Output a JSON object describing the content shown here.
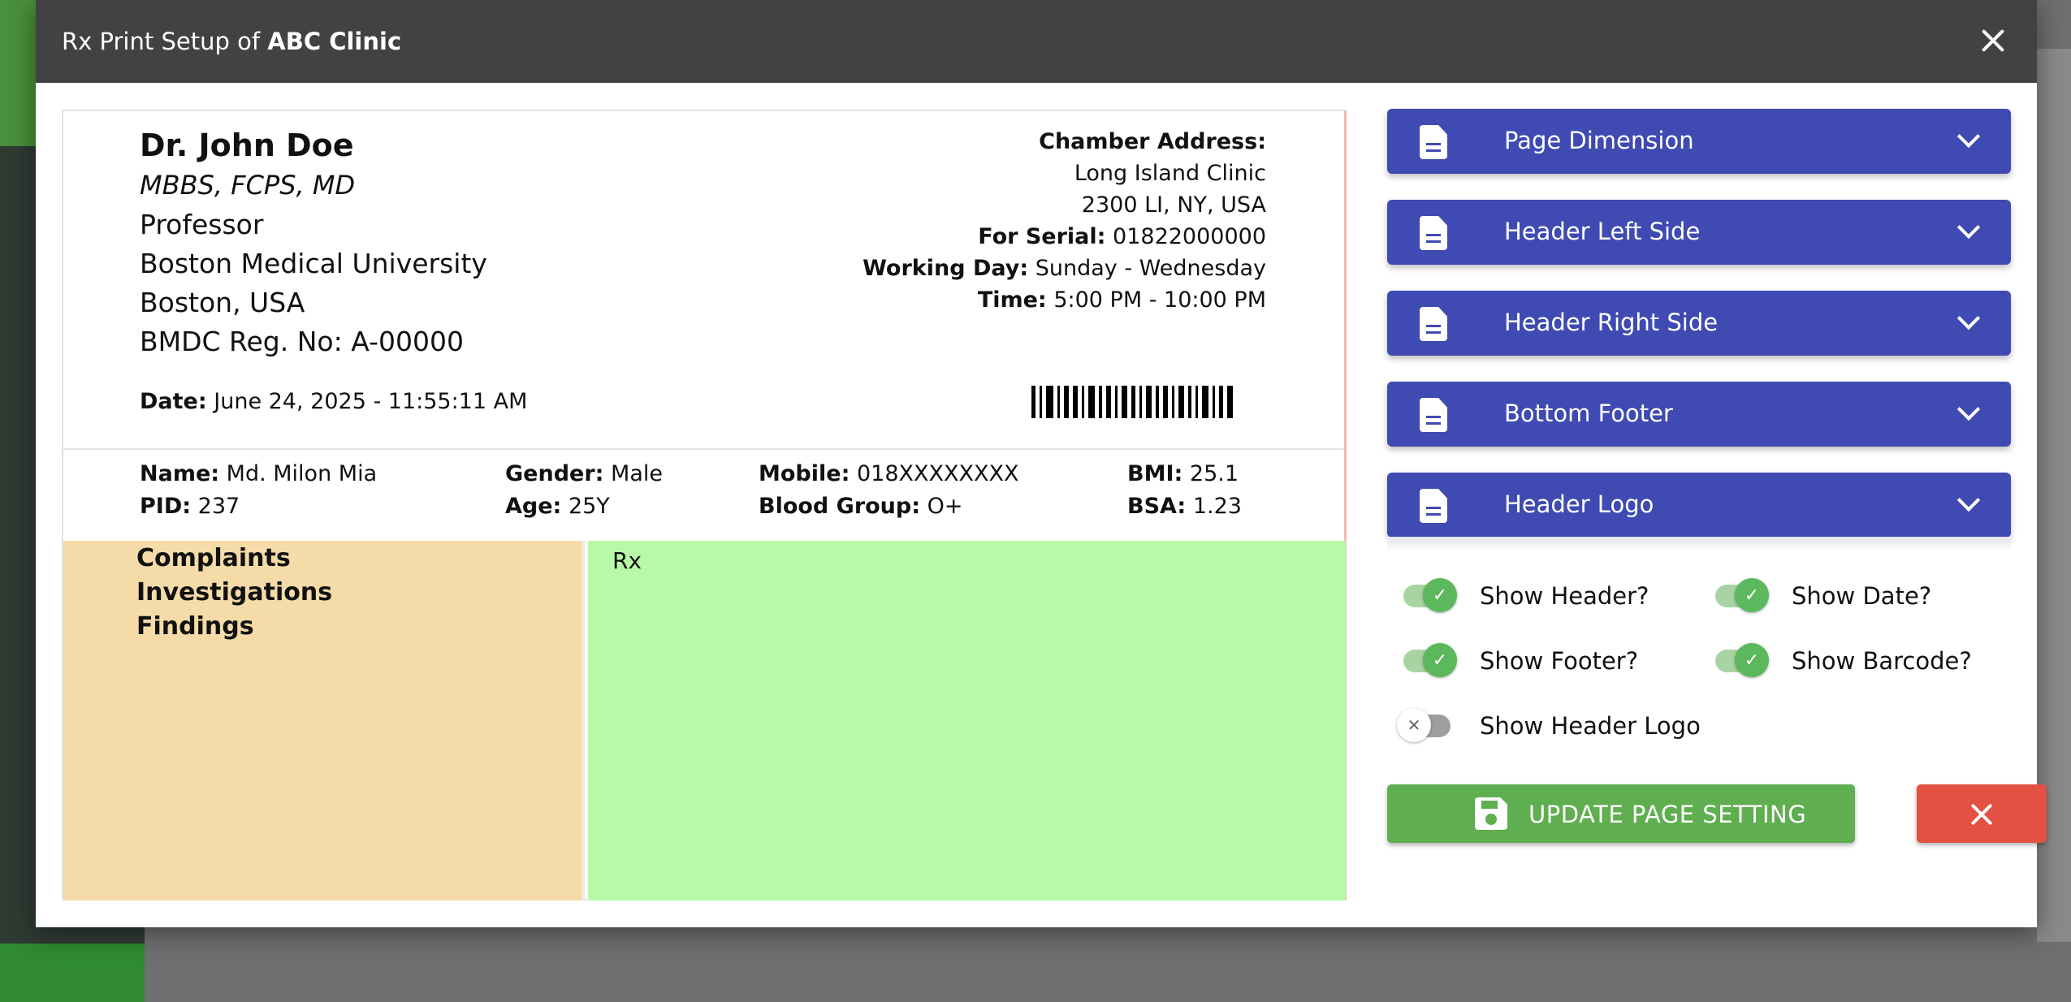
{
  "modal": {
    "title_prefix": "Rx Print Setup of ",
    "clinic_name": "ABC Clinic"
  },
  "doctor": {
    "name": "Dr. John Doe",
    "degrees": "MBBS, FCPS, MD",
    "title": "Professor",
    "institution": "Boston Medical University",
    "location": "Boston, USA",
    "registration": "BMDC Reg. No: A-00000"
  },
  "chamber": {
    "address_label": "Chamber Address:",
    "clinic": "Long Island Clinic",
    "address": "2300 LI, NY, USA",
    "serial_label": "For Serial:",
    "serial": "01822000000",
    "working_day_label": "Working Day:",
    "working_day": "Sunday - Wednesday",
    "time_label": "Time:",
    "time": "5:00 PM - 10:00 PM"
  },
  "date": {
    "label": "Date:",
    "value": "June 24, 2025 - 11:55:11 AM"
  },
  "patient": {
    "name_label": "Name:",
    "name": "Md. Milon Mia",
    "pid_label": "PID:",
    "pid": "237",
    "gender_label": "Gender:",
    "gender": "Male",
    "age_label": "Age:",
    "age": "25Y",
    "mobile_label": "Mobile:",
    "mobile": "018XXXXXXXX",
    "blood_label": "Blood Group:",
    "blood": "O+",
    "bmi_label": "BMI:",
    "bmi": "25.1",
    "bsa_label": "BSA:",
    "bsa": "1.23"
  },
  "left_sections": [
    "Complaints",
    "Investigations",
    "Findings"
  ],
  "rx_label": "Rx",
  "accordion": [
    {
      "label": "Page Dimension",
      "icon": "document-icon"
    },
    {
      "label": "Header Left Side",
      "icon": "document-icon"
    },
    {
      "label": "Header Right Side",
      "icon": "document-icon"
    },
    {
      "label": "Bottom Footer",
      "icon": "document-icon"
    },
    {
      "label": "Header Logo",
      "icon": "document-icon"
    }
  ],
  "toggles": {
    "show_header": {
      "label": "Show Header?",
      "on": true
    },
    "show_date": {
      "label": "Show Date?",
      "on": true
    },
    "show_footer": {
      "label": "Show Footer?",
      "on": true
    },
    "show_barcode": {
      "label": "Show Barcode?",
      "on": true
    },
    "show_header_logo": {
      "label": "Show Header Logo",
      "on": false
    }
  },
  "buttons": {
    "update_label": "UPDATE PAGE SETTING"
  },
  "colors": {
    "accordion": "#3f4ab3",
    "update_button": "#5fae4f",
    "cancel_button": "#e25141",
    "left_pane": "#f4dba8",
    "rx_pane": "#b8f9a7"
  }
}
